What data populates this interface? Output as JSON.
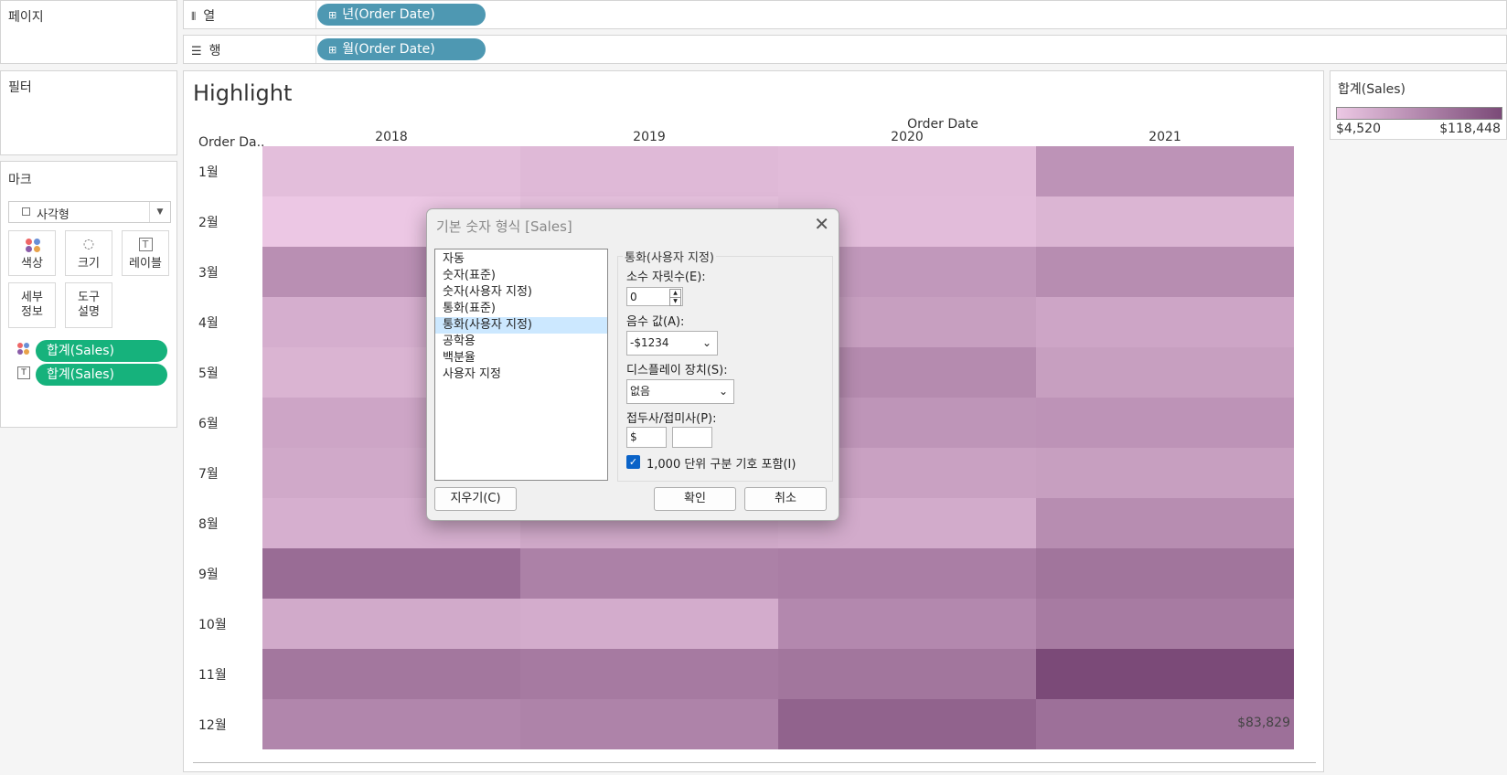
{
  "pages_title": "페이지",
  "filters_title": "필터",
  "marks": {
    "title": "마크",
    "type": "사각형",
    "buttons": [
      "색상",
      "크기",
      "레이블",
      "세부\n정보",
      "도구\n설명"
    ],
    "fields": [
      "합계(Sales)",
      "합계(Sales)"
    ]
  },
  "shelves": {
    "columns_label": "열",
    "columns_pill": "년(Order Date)",
    "rows_label": "행",
    "rows_pill": "월(Order Date)"
  },
  "viz": {
    "title": "Highlight",
    "row_header": "Order Da..",
    "col_header": "Order Date",
    "mark_label": "$83,829"
  },
  "legend": {
    "title": "합계(Sales)",
    "min": "$4,520",
    "max": "$118,448",
    "color_low": "#ecc8e4",
    "color_high": "#7b4a78"
  },
  "chart_data": {
    "type": "heatmap",
    "x": [
      "2018",
      "2019",
      "2020",
      "2021"
    ],
    "y": [
      "1월",
      "2월",
      "3월",
      "4월",
      "5월",
      "6월",
      "7월",
      "8월",
      "9월",
      "10월",
      "11월",
      "12월"
    ],
    "values": [
      [
        14000,
        18000,
        16000,
        52000
      ],
      [
        5000,
        11000,
        15000,
        22000
      ],
      [
        56000,
        42000,
        48000,
        58000
      ],
      [
        28000,
        30000,
        42000,
        36000
      ],
      [
        23000,
        40000,
        60000,
        42000
      ],
      [
        36000,
        37000,
        51000,
        52000
      ],
      [
        33000,
        38000,
        40000,
        42000
      ],
      [
        27000,
        33000,
        31000,
        58000
      ],
      [
        88000,
        69000,
        71000,
        80000
      ],
      [
        32000,
        30000,
        62000,
        74000
      ],
      [
        78000,
        75000,
        79000,
        118448
      ],
      [
        64000,
        67000,
        96000,
        83829
      ]
    ],
    "colorbar": {
      "min": 4520,
      "max": 118448
    }
  },
  "dialog": {
    "title": "기본 숫자 형식 [Sales]",
    "list": [
      "자동",
      "숫자(표준)",
      "숫자(사용자 지정)",
      "통화(표준)",
      "통화(사용자 지정)",
      "공학용",
      "백분율",
      "사용자 지정"
    ],
    "selected_index": 4,
    "group_title": "통화(사용자 지정)",
    "decimals_label": "소수 자릿수(E):",
    "decimals_value": "0",
    "negative_label": "음수 값(A):",
    "negative_value": "-$1234",
    "display_label": "디스플레이 장치(S):",
    "display_value": "없음",
    "prefix_label": "접두사/접미사(P):",
    "prefix_value": "$",
    "suffix_value": "",
    "thousands_label": "1,000 단위 구분 기호 포함(I)",
    "clear_label": "지우기(C)",
    "ok_label": "확인",
    "cancel_label": "취소"
  }
}
